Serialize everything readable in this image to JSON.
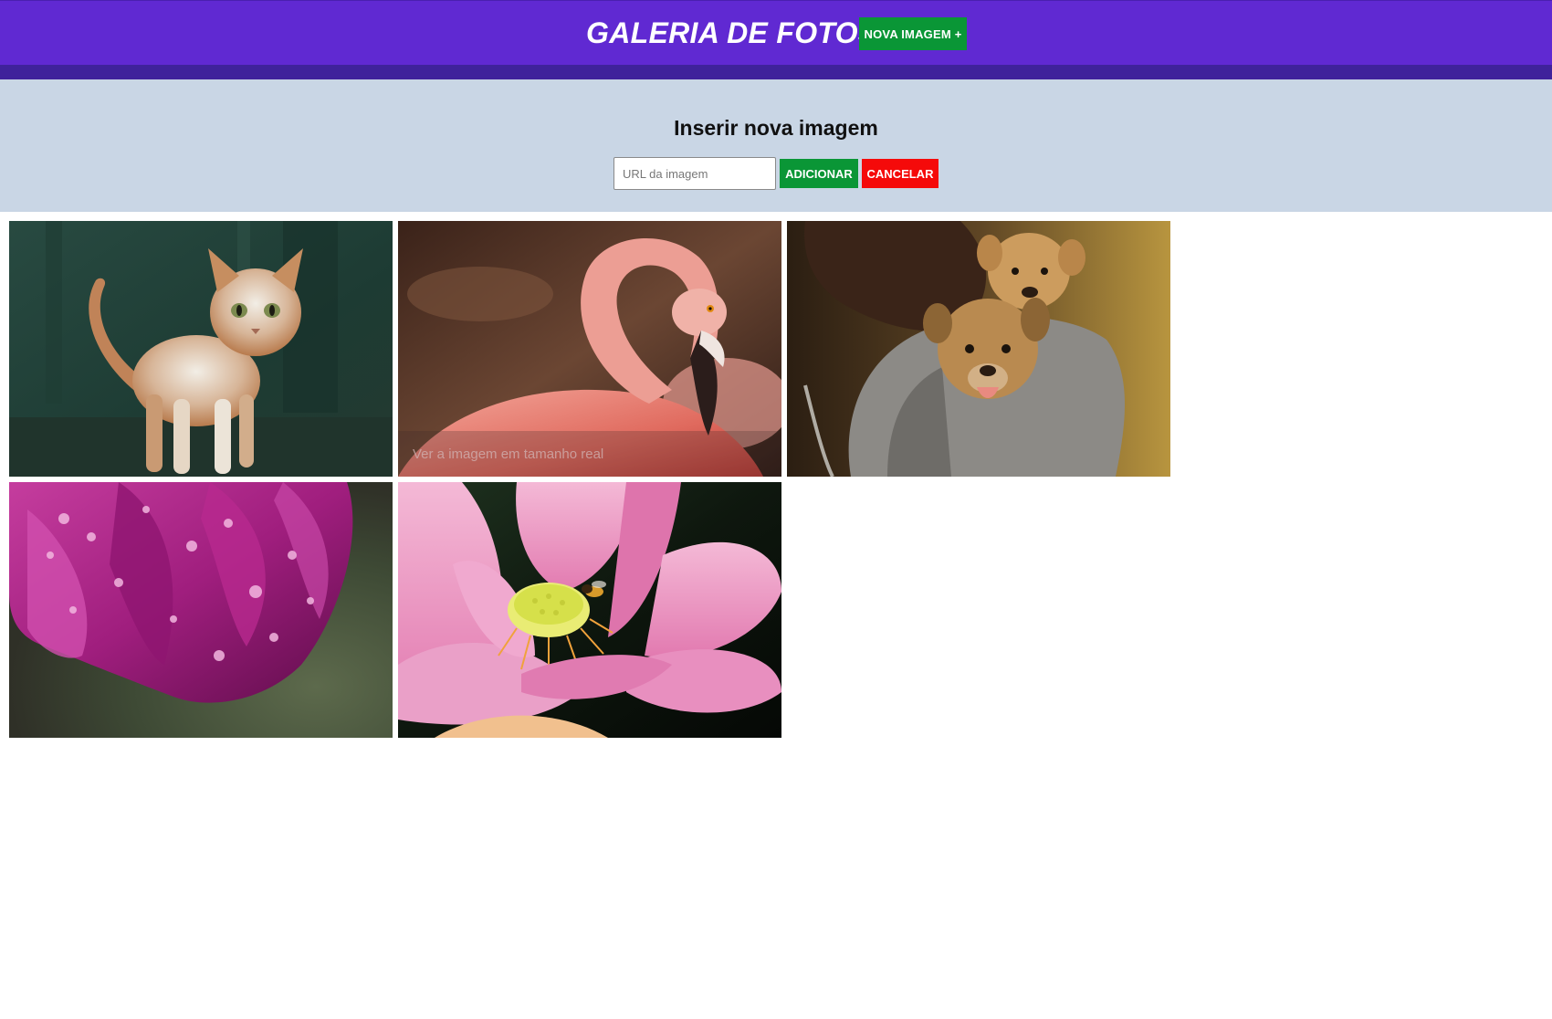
{
  "header": {
    "title": "GALERIA DE FOTOS",
    "new_image_button": "NOVA IMAGEM +",
    "bg_color": "#6029d2",
    "stripe_color": "#3f229b"
  },
  "insert_form": {
    "title": "Inserir nova imagem",
    "url_input": {
      "placeholder": "URL da imagem",
      "value": ""
    },
    "add_button": "ADICIONAR",
    "cancel_button": "CANCELAR",
    "bg_color": "#c9d6e5"
  },
  "gallery": {
    "hover_caption": "Ver a imagem em tamanho real",
    "hovered_index": 1,
    "images": [
      {
        "subject": "cat"
      },
      {
        "subject": "flamingo"
      },
      {
        "subject": "puppies"
      },
      {
        "subject": "magenta-rose-with-water-drops"
      },
      {
        "subject": "pink-lotus-with-bee"
      }
    ]
  }
}
